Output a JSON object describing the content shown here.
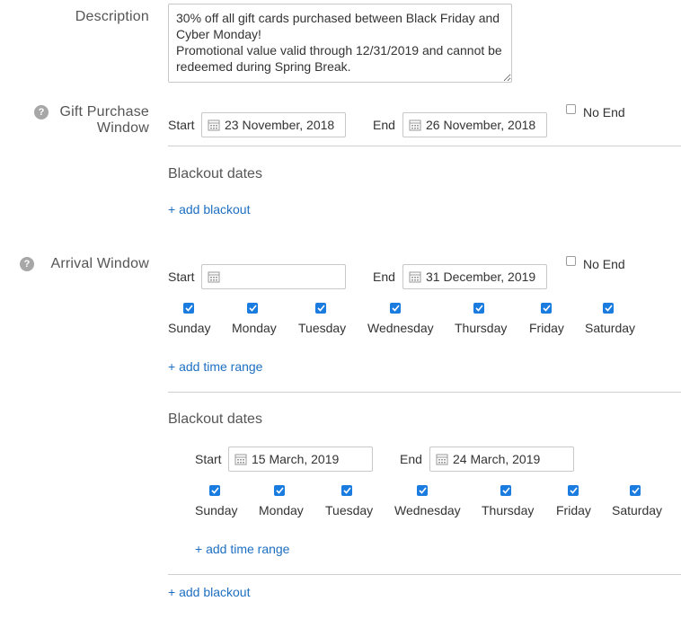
{
  "description": {
    "label": "Description",
    "value": "30% off all gift cards purchased between Black Friday and Cyber Monday!\nPromotional value valid through 12/31/2019 and cannot be redeemed during Spring Break."
  },
  "help_icon_glyph": "?",
  "gift_window": {
    "label_line1": "Gift Purchase",
    "label_line2": "Window",
    "start_label": "Start",
    "start_value": "23 November, 2018",
    "end_label": "End",
    "end_value": "26 November, 2018",
    "no_end_label": "No End",
    "no_end_checked": false,
    "blackout_title": "Blackout dates",
    "add_blackout": "+ add blackout"
  },
  "arrival_window": {
    "label": "Arrival Window",
    "start_label": "Start",
    "start_value": "",
    "end_label": "End",
    "end_value": "31 December, 2019",
    "no_end_label": "No End",
    "no_end_checked": false,
    "days": [
      {
        "label": "Sunday",
        "checked": true
      },
      {
        "label": "Monday",
        "checked": true
      },
      {
        "label": "Tuesday",
        "checked": true
      },
      {
        "label": "Wednesday",
        "checked": true
      },
      {
        "label": "Thursday",
        "checked": true
      },
      {
        "label": "Friday",
        "checked": true
      },
      {
        "label": "Saturday",
        "checked": true
      }
    ],
    "add_time_range": "+ add time range",
    "blackout_title": "Blackout dates",
    "blackout": {
      "start_label": "Start",
      "start_value": "15 March, 2019",
      "end_label": "End",
      "end_value": "24 March, 2019",
      "days": [
        {
          "label": "Sunday",
          "checked": true
        },
        {
          "label": "Monday",
          "checked": true
        },
        {
          "label": "Tuesday",
          "checked": true
        },
        {
          "label": "Wednesday",
          "checked": true
        },
        {
          "label": "Thursday",
          "checked": true
        },
        {
          "label": "Friday",
          "checked": true
        },
        {
          "label": "Saturday",
          "checked": true
        }
      ],
      "add_time_range": "+ add time range"
    },
    "add_blackout": "+ add blackout"
  },
  "colors": {
    "accent": "#1b7ce0",
    "link": "#1e6fc2",
    "help_icon": "#a7a7a7",
    "rule": "#cfcfcf"
  }
}
